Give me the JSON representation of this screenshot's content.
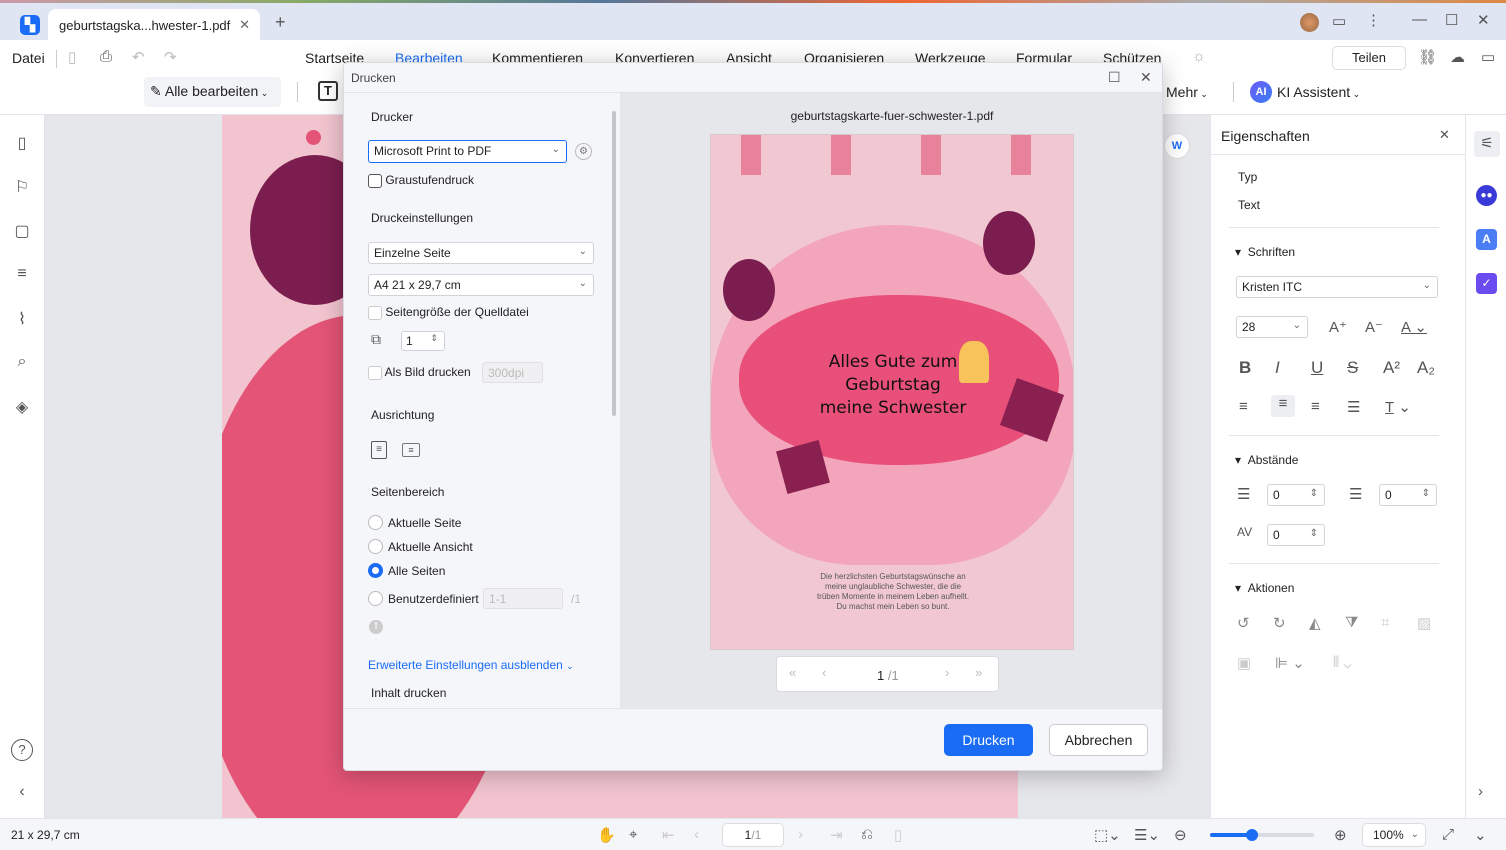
{
  "app": {
    "tab_title": "geburtstagska...hwester-1.pdf",
    "new_tab": "+",
    "file_menu": "Datei",
    "menu": [
      "Startseite",
      "Bearbeiten",
      "Kommentieren",
      "Konvertieren",
      "Ansicht",
      "Organisieren",
      "Werkzeuge",
      "Formular",
      "Schützen"
    ],
    "active_menu": "Bearbeiten",
    "share": "Teilen",
    "edit_all": "Alle bearbeiten",
    "more": "Mehr",
    "ai_badge": "AI",
    "ai_assistant": "KI Assistent",
    "accent": "#1a6cf5"
  },
  "properties": {
    "title": "Eigenschaften",
    "type_label": "Typ",
    "type_value": "Text",
    "fonts_section": "Schriften",
    "font_name": "Kristen ITC",
    "font_size": "28",
    "spacing_section": "Abstände",
    "line_spacing": "0",
    "para_spacing": "0",
    "char_spacing": "0",
    "actions_section": "Aktionen"
  },
  "status": {
    "page_size": "21 x 29,7 cm",
    "page_current": "1",
    "page_total": "/1",
    "zoom": "100%",
    "zoom_slider_fraction": 0.4
  },
  "dialog": {
    "title": "Drucken",
    "printer_section": "Drucker",
    "printer": "Microsoft Print to PDF",
    "grayscale": "Graustufendruck",
    "settings_section": "Druckeinstellungen",
    "page_mode": "Einzelne Seite",
    "paper": "A4 21 x 29,7 cm",
    "source_size": "Seitengröße der Quelldatei",
    "copies": "1",
    "as_image": "Als Bild drucken",
    "dpi": "300dpi",
    "orientation_section": "Ausrichtung",
    "range_section": "Seitenbereich",
    "range_options": [
      "Aktuelle Seite",
      "Aktuelle Ansicht",
      "Alle Seiten",
      "Benutzerdefiniert"
    ],
    "range_selected": "Alle Seiten",
    "custom_range": "1-1",
    "custom_total": "/1",
    "advanced_link": "Erweiterte Einstellungen ausblenden",
    "content_section": "Inhalt drucken",
    "preview_filename": "geburtstagskarte-fuer-schwester-1.pdf",
    "preview_page": "1",
    "preview_total": "/1",
    "print_button": "Drucken",
    "cancel_button": "Abbrechen"
  },
  "card": {
    "headline_1": "Alles Gute zum",
    "headline_2": "Geburtstag",
    "headline_3": "meine Schwester",
    "message_1": "Die herzlichsten Geburtstagswünsche an",
    "message_2": "meine unglaubliche Schwester, die die",
    "message_3": "trüben Momente in meinem Leben aufhellt.",
    "message_4": "Du machst mein Leben so bunt."
  }
}
